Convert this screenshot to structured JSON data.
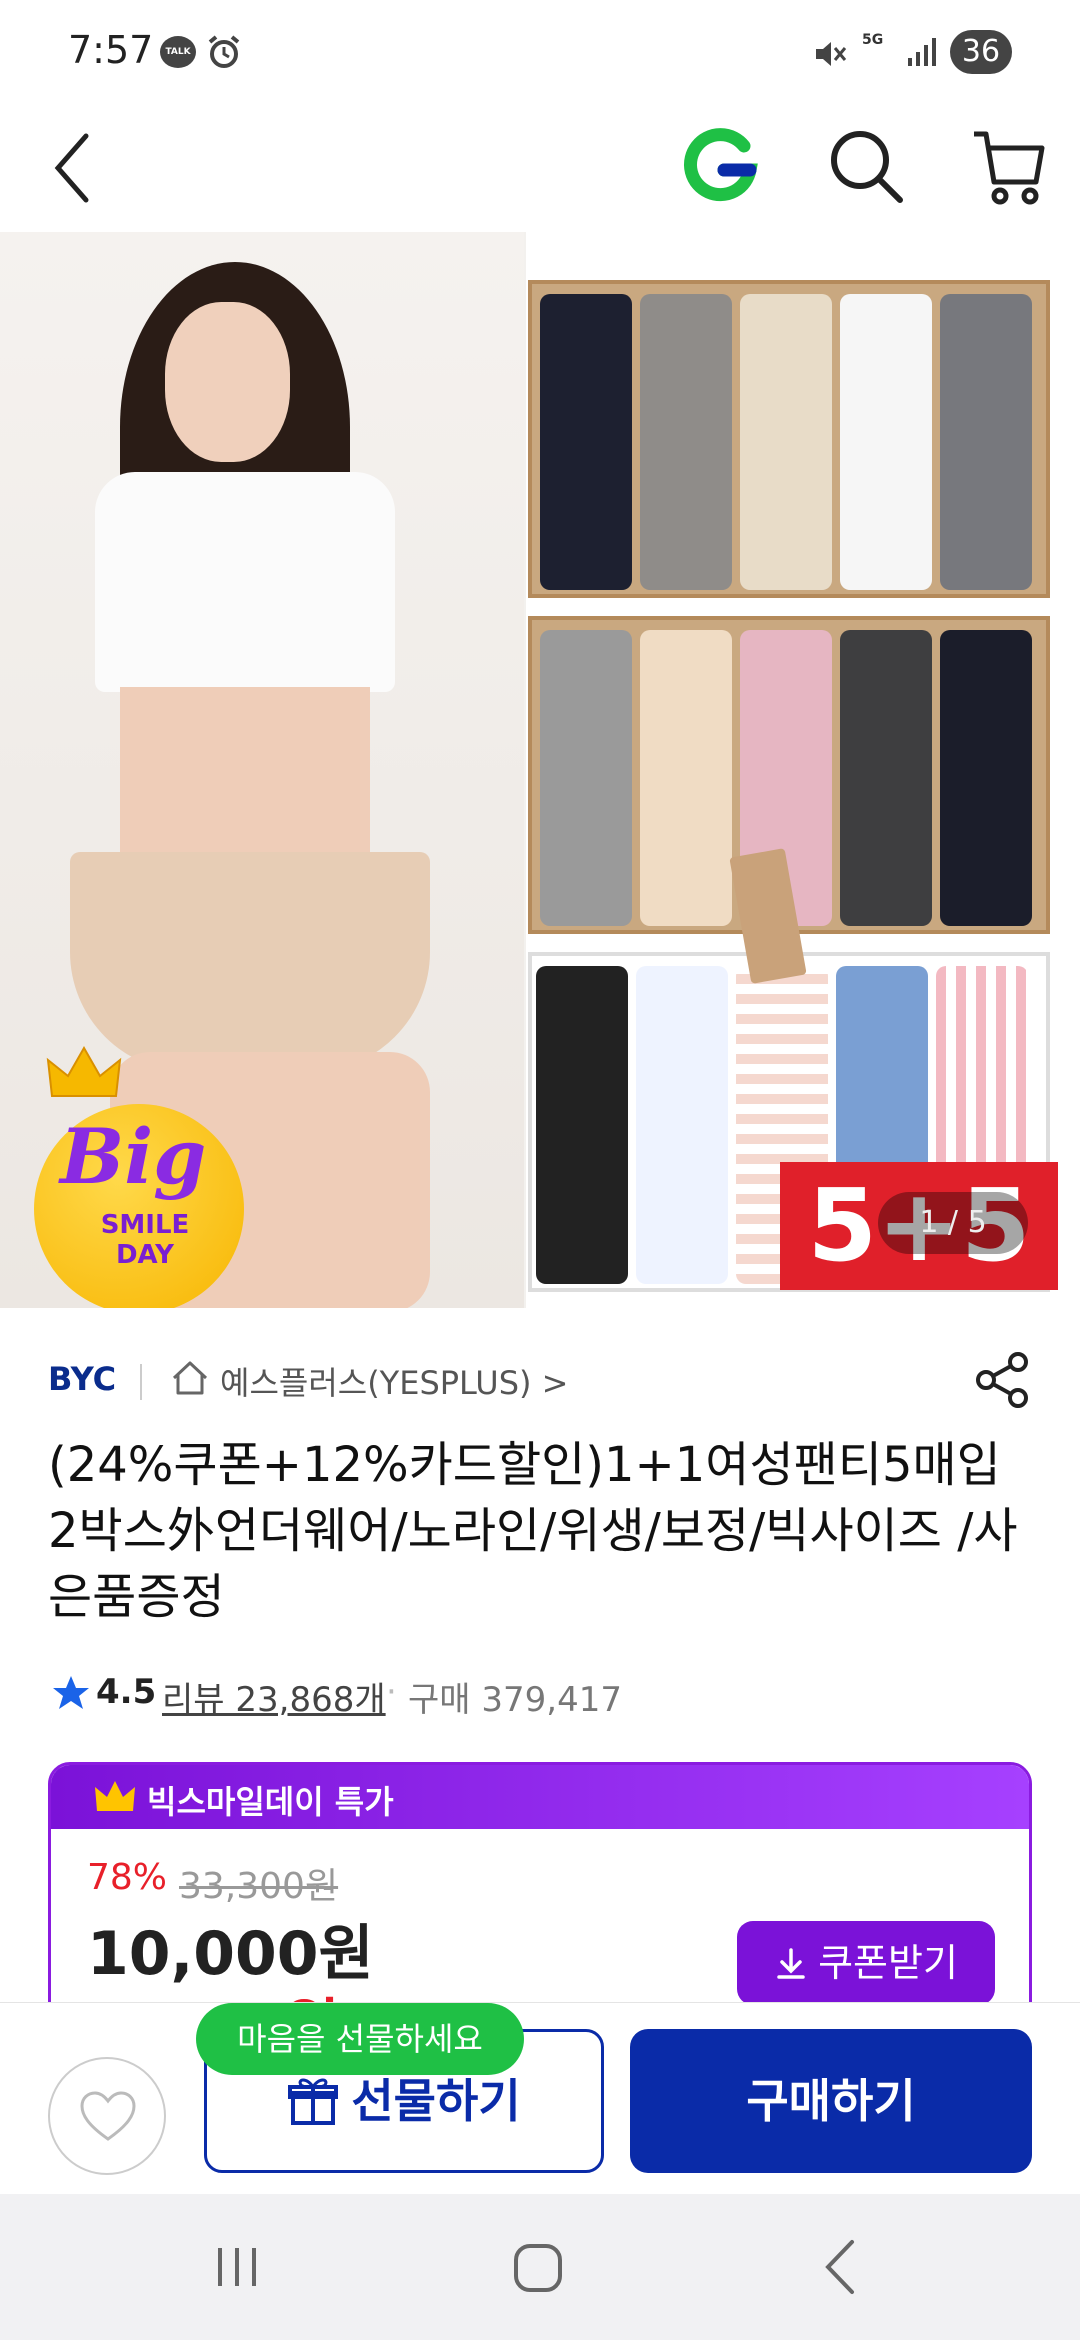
{
  "status_bar": {
    "time": "7:57",
    "talk_label": "TALK",
    "network": "5G",
    "battery": "36"
  },
  "header": {
    "back": "back-icon",
    "logo": "G",
    "icons": [
      "search-icon",
      "cart-icon"
    ],
    "brand_color": "#1fc045"
  },
  "product_image": {
    "badge_big": "Big",
    "badge_line1": "SMILE",
    "badge_line2": "DAY",
    "promo_text": "5+5",
    "counter": "1 / 5"
  },
  "product": {
    "brand": "BYC",
    "store": "예스플러스(YESPLUS) >",
    "title": "(24%쿠폰+12%카드할인)1+1여성팬티5매입 2박스外언더웨어/노라인/위생/보정/빅사이즈 /사은품증정",
    "rating": "4.5",
    "reviews": "리뷰 23,868개",
    "separator": "·",
    "purchases": "구매 379,417"
  },
  "deal": {
    "title": "빅스마일데이 특가",
    "discount": "78%",
    "original_price": "33,300원",
    "sale_price": "10,000원",
    "final_price": "7,300원",
    "coupon_button": "쿠폰받기",
    "accent_color": "#7b12d8"
  },
  "bottom_bar": {
    "gift_tooltip": "마음을 선물하세요",
    "gift_button": "선물하기",
    "buy_button": "구매하기",
    "primary_color": "#0a2ba8"
  },
  "system_nav": {
    "icons": [
      "recents-icon",
      "home-icon",
      "back-icon"
    ]
  }
}
